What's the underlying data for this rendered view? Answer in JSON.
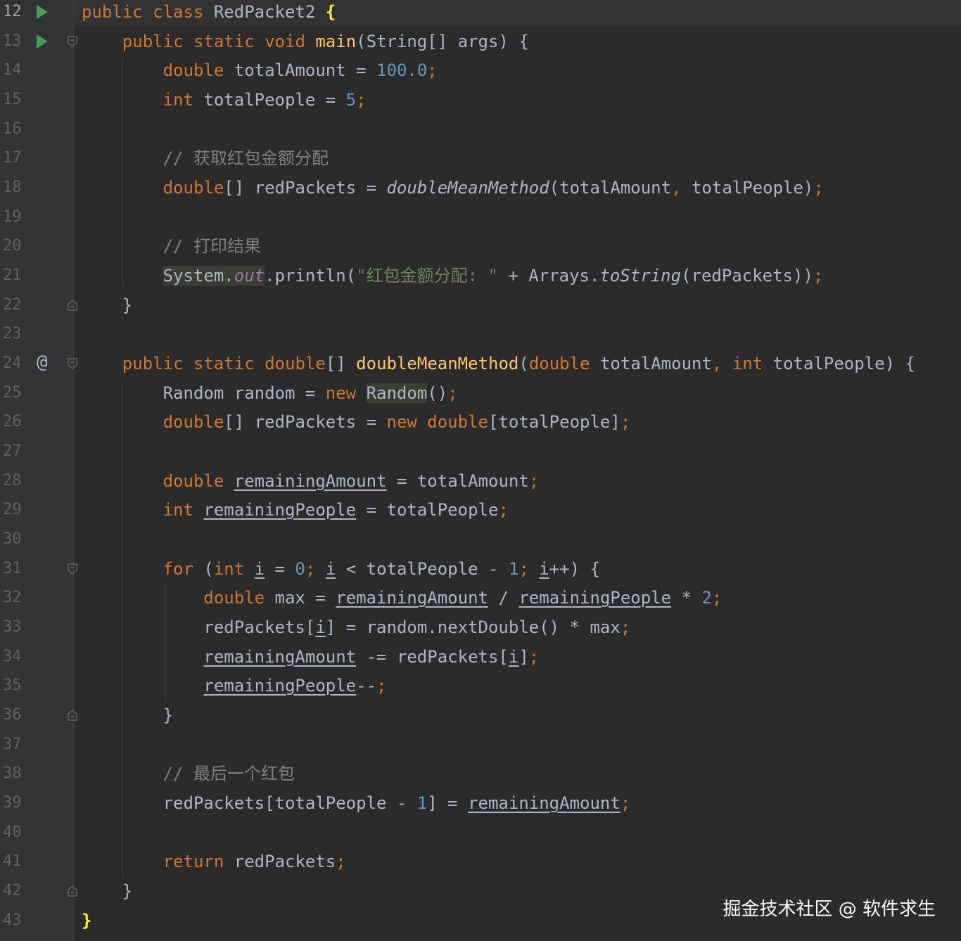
{
  "editor": {
    "lines": [
      {
        "num": "12",
        "icon": "run",
        "fold": "",
        "tokens": [
          [
            "kw",
            "public "
          ],
          [
            "kw",
            "class "
          ],
          [
            "",
            "RedPacket2 "
          ],
          [
            "brace-hl",
            "{"
          ]
        ]
      },
      {
        "num": "13",
        "icon": "run",
        "fold": "open",
        "tokens": [
          [
            "",
            "    "
          ],
          [
            "kw",
            "public "
          ],
          [
            "kw",
            "static "
          ],
          [
            "kw",
            "void "
          ],
          [
            "fn",
            "main"
          ],
          [
            "",
            "(String[] args) {"
          ]
        ]
      },
      {
        "num": "14",
        "icon": "",
        "fold": "",
        "tokens": [
          [
            "",
            "        "
          ],
          [
            "kw",
            "double "
          ],
          [
            "",
            "totalAmount = "
          ],
          [
            "num",
            "100.0"
          ],
          [
            "kw",
            ";"
          ]
        ]
      },
      {
        "num": "15",
        "icon": "",
        "fold": "",
        "tokens": [
          [
            "",
            "        "
          ],
          [
            "kw",
            "int "
          ],
          [
            "",
            "totalPeople = "
          ],
          [
            "num",
            "5"
          ],
          [
            "kw",
            ";"
          ]
        ]
      },
      {
        "num": "16",
        "icon": "",
        "fold": "",
        "tokens": []
      },
      {
        "num": "17",
        "icon": "",
        "fold": "",
        "tokens": [
          [
            "",
            "        "
          ],
          [
            "cmt",
            "// 获取红包金额分配"
          ]
        ]
      },
      {
        "num": "18",
        "icon": "",
        "fold": "",
        "tokens": [
          [
            "",
            "        "
          ],
          [
            "kw",
            "double"
          ],
          [
            "",
            "[] redPackets = "
          ],
          [
            "it",
            "doubleMeanMethod"
          ],
          [
            "",
            "(totalAmount"
          ],
          [
            "kw",
            ", "
          ],
          [
            "",
            "totalPeople)"
          ],
          [
            "kw",
            ";"
          ]
        ]
      },
      {
        "num": "19",
        "icon": "",
        "fold": "",
        "tokens": []
      },
      {
        "num": "20",
        "icon": "",
        "fold": "",
        "tokens": [
          [
            "",
            "        "
          ],
          [
            "cmt",
            "// 打印结果"
          ]
        ]
      },
      {
        "num": "21",
        "icon": "",
        "fold": "",
        "tokens": [
          [
            "",
            "        "
          ],
          [
            "hl",
            "System."
          ],
          [
            "hl field",
            "out"
          ],
          [
            "",
            ".println("
          ],
          [
            "str",
            "\"红包金额分配: \""
          ],
          [
            "",
            " + Arrays."
          ],
          [
            "it",
            "toString"
          ],
          [
            "",
            "(redPackets))"
          ],
          [
            "kw",
            ";"
          ]
        ]
      },
      {
        "num": "22",
        "icon": "",
        "fold": "close",
        "tokens": [
          [
            "",
            "    }"
          ]
        ]
      },
      {
        "num": "23",
        "icon": "",
        "fold": "",
        "tokens": []
      },
      {
        "num": "24",
        "icon": "at",
        "fold": "open",
        "tokens": [
          [
            "",
            "    "
          ],
          [
            "kw",
            "public "
          ],
          [
            "kw",
            "static "
          ],
          [
            "kw",
            "double"
          ],
          [
            "",
            "[] "
          ],
          [
            "fn",
            "doubleMeanMethod"
          ],
          [
            "",
            "("
          ],
          [
            "kw",
            "double "
          ],
          [
            "",
            "totalAmount"
          ],
          [
            "kw",
            ", "
          ],
          [
            "kw",
            "int "
          ],
          [
            "",
            "totalPeople) {"
          ]
        ]
      },
      {
        "num": "25",
        "icon": "",
        "fold": "",
        "tokens": [
          [
            "",
            "        Random random = "
          ],
          [
            "kw",
            "new "
          ],
          [
            "hl",
            "Random"
          ],
          [
            "",
            "()"
          ],
          [
            "kw",
            ";"
          ]
        ]
      },
      {
        "num": "26",
        "icon": "",
        "fold": "",
        "tokens": [
          [
            "",
            "        "
          ],
          [
            "kw",
            "double"
          ],
          [
            "",
            "[] redPackets = "
          ],
          [
            "kw",
            "new "
          ],
          [
            "kw",
            "double"
          ],
          [
            "",
            "[totalPeople]"
          ],
          [
            "kw",
            ";"
          ]
        ]
      },
      {
        "num": "27",
        "icon": "",
        "fold": "",
        "tokens": []
      },
      {
        "num": "28",
        "icon": "",
        "fold": "",
        "tokens": [
          [
            "",
            "        "
          ],
          [
            "kw",
            "double "
          ],
          [
            "ul",
            "remainingAmount"
          ],
          [
            "",
            " = totalAmount"
          ],
          [
            "kw",
            ";"
          ]
        ]
      },
      {
        "num": "29",
        "icon": "",
        "fold": "",
        "tokens": [
          [
            "",
            "        "
          ],
          [
            "kw",
            "int "
          ],
          [
            "ul",
            "remainingPeople"
          ],
          [
            "",
            " = totalPeople"
          ],
          [
            "kw",
            ";"
          ]
        ]
      },
      {
        "num": "30",
        "icon": "",
        "fold": "",
        "tokens": []
      },
      {
        "num": "31",
        "icon": "",
        "fold": "open",
        "tokens": [
          [
            "",
            "        "
          ],
          [
            "kw",
            "for "
          ],
          [
            "",
            "("
          ],
          [
            "kw",
            "int "
          ],
          [
            "ul",
            "i"
          ],
          [
            "",
            " = "
          ],
          [
            "num",
            "0"
          ],
          [
            "kw",
            "; "
          ],
          [
            "ul",
            "i"
          ],
          [
            "",
            " < totalPeople - "
          ],
          [
            "num",
            "1"
          ],
          [
            "kw",
            "; "
          ],
          [
            "ul",
            "i"
          ],
          [
            "",
            "++) {"
          ]
        ]
      },
      {
        "num": "32",
        "icon": "",
        "fold": "",
        "tokens": [
          [
            "",
            "            "
          ],
          [
            "kw",
            "double "
          ],
          [
            "",
            "max = "
          ],
          [
            "ul",
            "remainingAmount"
          ],
          [
            "",
            " / "
          ],
          [
            "ul",
            "remainingPeople"
          ],
          [
            "",
            " * "
          ],
          [
            "num",
            "2"
          ],
          [
            "kw",
            ";"
          ]
        ]
      },
      {
        "num": "33",
        "icon": "",
        "fold": "",
        "tokens": [
          [
            "",
            "            redPackets["
          ],
          [
            "ul",
            "i"
          ],
          [
            "",
            "] = random.nextDouble() * max"
          ],
          [
            "kw",
            ";"
          ]
        ]
      },
      {
        "num": "34",
        "icon": "",
        "fold": "",
        "tokens": [
          [
            "",
            "            "
          ],
          [
            "ul",
            "remainingAmount"
          ],
          [
            "",
            " -= redPackets["
          ],
          [
            "ul",
            "i"
          ],
          [
            "",
            "]"
          ],
          [
            "kw",
            ";"
          ]
        ]
      },
      {
        "num": "35",
        "icon": "",
        "fold": "",
        "tokens": [
          [
            "",
            "            "
          ],
          [
            "ul",
            "remainingPeople"
          ],
          [
            "",
            "--"
          ],
          [
            "kw",
            ";"
          ]
        ]
      },
      {
        "num": "36",
        "icon": "",
        "fold": "close",
        "tokens": [
          [
            "",
            "        }"
          ]
        ]
      },
      {
        "num": "37",
        "icon": "",
        "fold": "",
        "tokens": []
      },
      {
        "num": "38",
        "icon": "",
        "fold": "",
        "tokens": [
          [
            "",
            "        "
          ],
          [
            "cmt",
            "// 最后一个红包"
          ]
        ]
      },
      {
        "num": "39",
        "icon": "",
        "fold": "",
        "tokens": [
          [
            "",
            "        redPackets[totalPeople - "
          ],
          [
            "num",
            "1"
          ],
          [
            "",
            "] = "
          ],
          [
            "ul",
            "remainingAmount"
          ],
          [
            "kw",
            ";"
          ]
        ]
      },
      {
        "num": "40",
        "icon": "",
        "fold": "",
        "tokens": []
      },
      {
        "num": "41",
        "icon": "",
        "fold": "",
        "tokens": [
          [
            "",
            "        "
          ],
          [
            "kw",
            "return "
          ],
          [
            "",
            "redPackets"
          ],
          [
            "kw",
            ";"
          ]
        ]
      },
      {
        "num": "42",
        "icon": "",
        "fold": "close",
        "tokens": [
          [
            "",
            "    }"
          ]
        ]
      },
      {
        "num": "43",
        "icon": "",
        "fold": "",
        "tokens": [
          [
            "brace-hl",
            "}"
          ]
        ]
      }
    ]
  },
  "watermark": "掘金技术社区 @ 软件求生",
  "colors": {
    "background": "#2b2b2b",
    "gutter": "#313335",
    "keyword": "#cc7832",
    "number": "#6897bb",
    "comment": "#808080",
    "string": "#6a8759",
    "method": "#ffc66d",
    "field": "#9876aa",
    "text": "#a9b7c6"
  }
}
